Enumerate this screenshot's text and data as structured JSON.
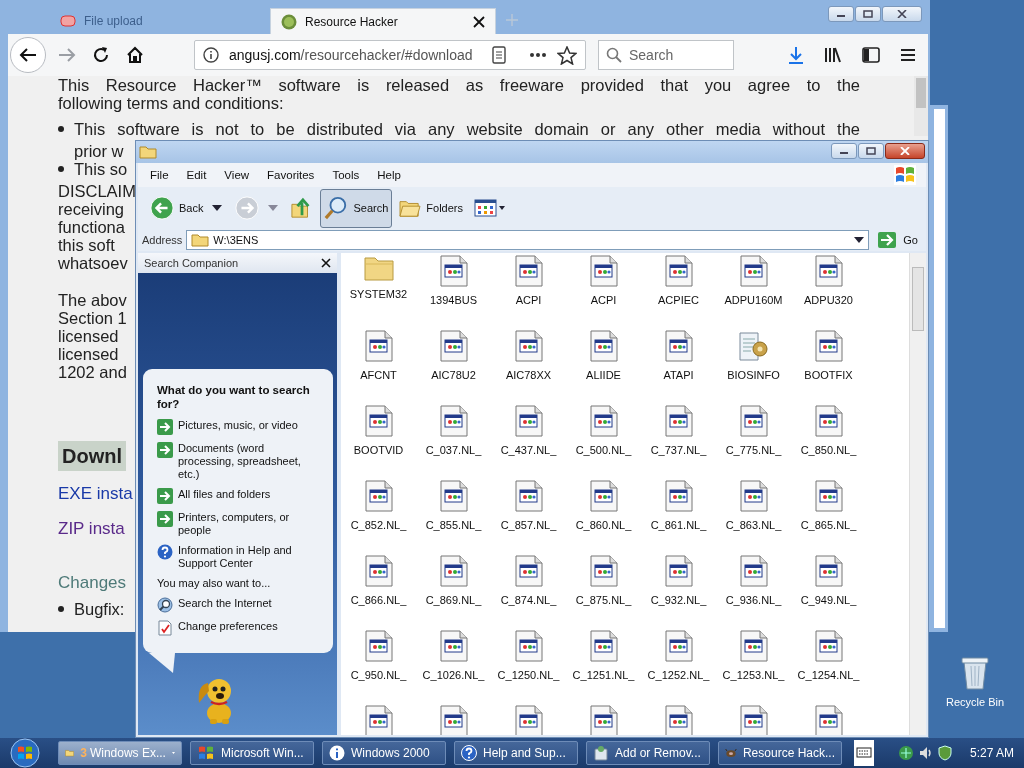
{
  "browser": {
    "tabs": [
      {
        "title": "File upload",
        "selected": false
      },
      {
        "title": "Resource Hacker",
        "selected": true
      }
    ],
    "nav_buttons": [
      {
        "kind": "back",
        "disabled": false
      },
      {
        "kind": "forward",
        "disabled": true
      },
      {
        "kind": "reload",
        "disabled": false
      },
      {
        "kind": "home",
        "disabled": false
      }
    ],
    "url": {
      "host": "angusj.com",
      "path": "/resourcehacker/#download"
    },
    "search": {
      "placeholder": "Search"
    },
    "content": [
      {
        "kind": "justified",
        "text": "This Resource Hacker™ software is released as freeware provided that you agree to the"
      },
      {
        "kind": "line",
        "text": "following terms and conditions:"
      },
      {
        "kind": "bullet-justified",
        "text": "This software is not to be distributed via any website domain or any other media without the"
      },
      {
        "kind": "indent",
        "text": "prior w"
      },
      {
        "kind": "bullet",
        "text": "This so"
      },
      {
        "kind": "line",
        "text": "DISCLAIM"
      },
      {
        "kind": "line",
        "text": "receiving"
      },
      {
        "kind": "line",
        "text": "functiona"
      },
      {
        "kind": "line",
        "text": "this soft"
      },
      {
        "kind": "line",
        "text": "whatsoev"
      },
      {
        "kind": "para",
        "text": "The abov"
      },
      {
        "kind": "line",
        "text": "Section 1"
      },
      {
        "kind": "line",
        "text": "licensed"
      },
      {
        "kind": "line",
        "text": "licensed"
      },
      {
        "kind": "line",
        "text": "1202 and"
      },
      {
        "kind": "heading",
        "text": "Downl"
      },
      {
        "kind": "link",
        "text": "EXE insta",
        "visited": false
      },
      {
        "kind": "link",
        "text": "ZIP insta",
        "visited": true
      },
      {
        "kind": "subheading",
        "text": "Changes"
      },
      {
        "kind": "bullet",
        "text": "Bugfix:"
      }
    ]
  },
  "explorer": {
    "menu": [
      "File",
      "Edit",
      "View",
      "Favorites",
      "Tools",
      "Help"
    ],
    "toolbar": [
      {
        "kind": "back",
        "label": "Back",
        "selected": false,
        "disabled": false
      },
      {
        "kind": "forward",
        "selected": false,
        "disabled": true
      },
      {
        "kind": "up",
        "selected": false
      },
      {
        "kind": "search",
        "label": "Search",
        "selected": true
      },
      {
        "kind": "folders",
        "label": "Folders",
        "selected": false
      },
      {
        "kind": "views",
        "selected": false
      }
    ],
    "address": {
      "label": "Address",
      "value": "W:\\3ENS",
      "go": "Go"
    },
    "search_companion": {
      "title": "Search Companion",
      "question": "What do you want to search for?",
      "options": [
        {
          "kind": "arrow",
          "text": "Pictures, music, or video"
        },
        {
          "kind": "arrow",
          "text": "Documents (word processing, spreadsheet, etc.)"
        },
        {
          "kind": "arrow",
          "text": "All files and folders"
        },
        {
          "kind": "arrow",
          "text": "Printers, computers, or people"
        },
        {
          "kind": "help",
          "text": "Information in Help and Support Center"
        }
      ],
      "also_label": "You may also want to...",
      "also": [
        {
          "kind": "internet",
          "text": "Search the Internet"
        },
        {
          "kind": "preferences",
          "text": "Change preferences"
        }
      ]
    },
    "files": [
      {
        "kind": "folder",
        "name": "SYSTEM32"
      },
      {
        "kind": "file",
        "name": "1394BUS"
      },
      {
        "kind": "file",
        "name": "ACPI"
      },
      {
        "kind": "file",
        "name": "ACPI"
      },
      {
        "kind": "file",
        "name": "ACPIEC"
      },
      {
        "kind": "file",
        "name": "ADPU160M"
      },
      {
        "kind": "file",
        "name": "ADPU320"
      },
      {
        "kind": "file",
        "name": "AFCNT"
      },
      {
        "kind": "file",
        "name": "AIC78U2"
      },
      {
        "kind": "file",
        "name": "AIC78XX"
      },
      {
        "kind": "file",
        "name": "ALIIDE"
      },
      {
        "kind": "file",
        "name": "ATAPI"
      },
      {
        "kind": "script",
        "name": "BIOSINFO"
      },
      {
        "kind": "file",
        "name": "BOOTFIX"
      },
      {
        "kind": "file",
        "name": "BOOTVID"
      },
      {
        "kind": "file",
        "name": "C_037.NL_"
      },
      {
        "kind": "file",
        "name": "C_437.NL_"
      },
      {
        "kind": "file",
        "name": "C_500.NL_"
      },
      {
        "kind": "file",
        "name": "C_737.NL_"
      },
      {
        "kind": "file",
        "name": "C_775.NL_"
      },
      {
        "kind": "file",
        "name": "C_850.NL_"
      },
      {
        "kind": "file",
        "name": "C_852.NL_"
      },
      {
        "kind": "file",
        "name": "C_855.NL_"
      },
      {
        "kind": "file",
        "name": "C_857.NL_"
      },
      {
        "kind": "file",
        "name": "C_860.NL_"
      },
      {
        "kind": "file",
        "name": "C_861.NL_"
      },
      {
        "kind": "file",
        "name": "C_863.NL_"
      },
      {
        "kind": "file",
        "name": "C_865.NL_"
      },
      {
        "kind": "file",
        "name": "C_866.NL_"
      },
      {
        "kind": "file",
        "name": "C_869.NL_"
      },
      {
        "kind": "file",
        "name": "C_874.NL_"
      },
      {
        "kind": "file",
        "name": "C_875.NL_"
      },
      {
        "kind": "file",
        "name": "C_932.NL_"
      },
      {
        "kind": "file",
        "name": "C_936.NL_"
      },
      {
        "kind": "file",
        "name": "C_949.NL_"
      },
      {
        "kind": "file",
        "name": "C_950.NL_"
      },
      {
        "kind": "file",
        "name": "C_1026.NL_"
      },
      {
        "kind": "file",
        "name": "C_1250.NL_"
      },
      {
        "kind": "file",
        "name": "C_1251.NL_"
      },
      {
        "kind": "file",
        "name": "C_1252.NL_"
      },
      {
        "kind": "file",
        "name": "C_1253.NL_"
      },
      {
        "kind": "file",
        "name": "C_1254.NL_"
      },
      {
        "kind": "file"
      },
      {
        "kind": "file"
      },
      {
        "kind": "file"
      },
      {
        "kind": "file"
      },
      {
        "kind": "file"
      },
      {
        "kind": "file"
      },
      {
        "kind": "file"
      }
    ]
  },
  "desktop": {
    "icons": [
      {
        "kind": "recycle-bin",
        "label": "Recycle Bin"
      }
    ]
  },
  "taskbar": {
    "tasks": [
      {
        "kind": "folder",
        "count": "3",
        "label": "Windows Ex...",
        "selected": true
      },
      {
        "kind": "windows",
        "label": "Microsoft Win...",
        "selected": false
      },
      {
        "kind": "info",
        "label": "Windows 2000",
        "selected": false
      },
      {
        "kind": "help",
        "label": "Help and Sup...",
        "selected": false
      },
      {
        "kind": "control",
        "label": "Add or Remov...",
        "selected": false
      },
      {
        "kind": "app",
        "label": "Resource Hack...",
        "selected": false
      }
    ],
    "clock": "5:27 AM"
  }
}
